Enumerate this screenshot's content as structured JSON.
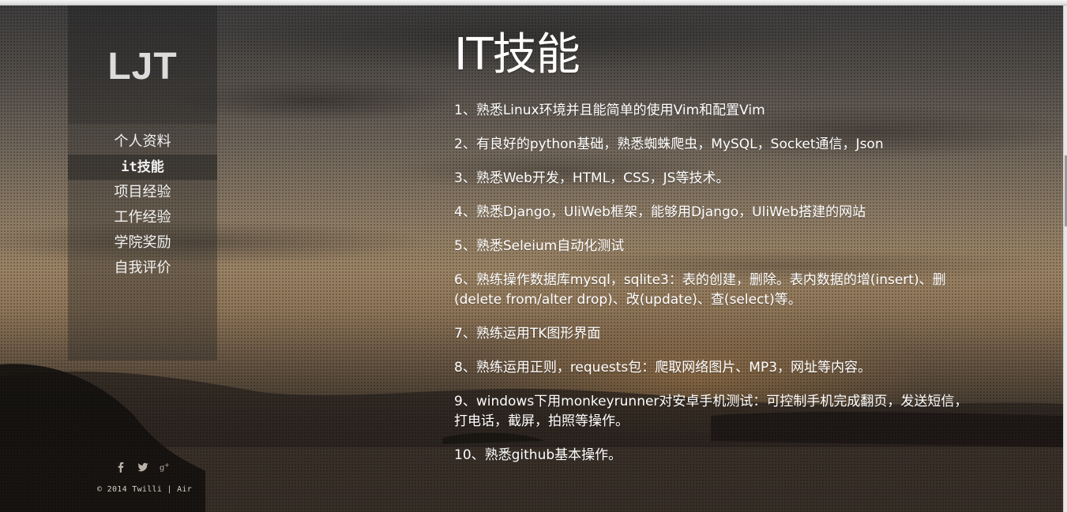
{
  "sidebar": {
    "logo": "LJT",
    "nav": [
      {
        "label": "个人资料",
        "active": false
      },
      {
        "label": "it技能",
        "active": true
      },
      {
        "label": "项目经验",
        "active": false
      },
      {
        "label": "工作经验",
        "active": false
      },
      {
        "label": "学院奖励",
        "active": false
      },
      {
        "label": "自我评价",
        "active": false
      }
    ],
    "social": [
      "facebook-icon",
      "twitter-icon",
      "google-plus-icon"
    ],
    "copyright": "© 2014 Twilli | Air"
  },
  "main": {
    "title": "IT技能",
    "skills": [
      "1、熟悉Linux环境并且能简单的使用Vim和配置Vim",
      "2、有良好的python基础，熟悉蜘蛛爬虫，MySQL，Socket通信，Json",
      "3、熟悉Web开发，HTML，CSS，JS等技术。",
      "4、熟悉Django，UliWeb框架，能够用Django，UliWeb搭建的网站",
      "5、熟悉Seleium自动化测试",
      "6、熟练操作数据库mysql，sqlite3：表的创建，删除。表内数据的增(insert)、删(delete from/alter drop)、改(update)、查(select)等。",
      "7、熟练运用TK图形界面",
      "8、熟练运用正则，requests包：爬取网络图片、MP3，网址等内容。",
      "9、windows下用monkeyrunner对安卓手机测试：可控制手机完成翻页，发送短信，打电话，截屏，拍照等操作。",
      "10、熟悉github基本操作。"
    ]
  }
}
